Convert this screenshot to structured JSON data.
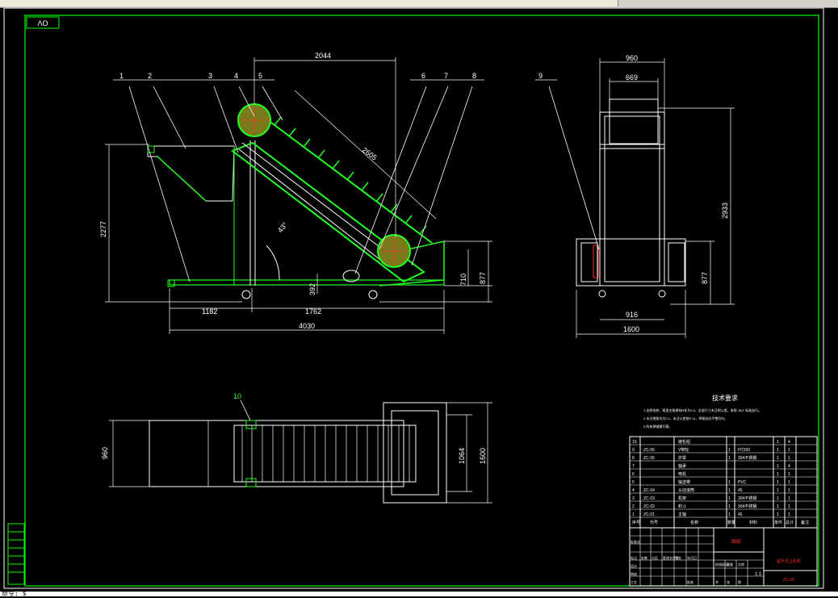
{
  "drawing_code": "ΛO",
  "side_view": {
    "part_numbers": [
      "1",
      "2",
      "3",
      "4",
      "5",
      "6",
      "7",
      "8"
    ],
    "dims": {
      "top_length": "2044",
      "conveyor_length": "2605",
      "overall_height": "2277",
      "angle": "43°",
      "low_height": "392",
      "discharge_height": "710",
      "end_height": "877",
      "base_left": "1182",
      "base_right": "1762",
      "overall_length": "4030"
    }
  },
  "end_view": {
    "part_number": "9",
    "dims": {
      "top_width": "960",
      "inner_width": "669",
      "height": "2933",
      "side_height": "877",
      "wheel_span": "916",
      "overall_width": "1600"
    }
  },
  "plan_view": {
    "part_number": "10",
    "dims": {
      "width_left": "960",
      "width_mid": "1064",
      "width_right": "1600"
    }
  },
  "notes": {
    "title": "技术要求",
    "lines": [
      "1.去除毛刺，铸造尖角倒钝R处为0.5，全部尺寸未注明公差，参照 JB/T 标准执行。",
      "2.未注倒角均为C1，未注公差按IT14，焊接处应平整均匀。",
      "3.所有焊缝需打磨。"
    ]
  },
  "bom": {
    "rows": [
      {
        "no": "10",
        "code": "",
        "name": "链轮组",
        "qty": "",
        "material": "",
        "a": "1",
        "b": "4"
      },
      {
        "no": "9",
        "code": "ZC-06",
        "name": "V带轮",
        "qty": "1",
        "material": "HT200",
        "a": "1",
        "b": "1"
      },
      {
        "no": "8",
        "code": "ZC-05",
        "name": "护罩",
        "qty": "1",
        "material": "304不锈钢",
        "a": "1",
        "b": "1"
      },
      {
        "no": "7",
        "code": "",
        "name": "轴承",
        "qty": "",
        "material": "",
        "a": "1",
        "b": "4"
      },
      {
        "no": "6",
        "code": "",
        "name": "电机",
        "qty": "",
        "material": "",
        "a": "1",
        "b": "1"
      },
      {
        "no": "5",
        "code": "",
        "name": "输送带",
        "qty": "1",
        "material": "PVC",
        "a": "1",
        "b": "1"
      },
      {
        "no": "4",
        "code": "ZC-04",
        "name": "从动滚筒",
        "qty": "1",
        "material": "45",
        "a": "1",
        "b": "1"
      },
      {
        "no": "3",
        "code": "ZC-03",
        "name": "机架",
        "qty": "1",
        "material": "304不锈钢",
        "a": "1",
        "b": "1"
      },
      {
        "no": "2",
        "code": "ZC-02",
        "name": "料斗",
        "qty": "1",
        "material": "304不锈钢",
        "a": "1",
        "b": "1"
      },
      {
        "no": "1",
        "code": "ZC-01",
        "name": "主轴",
        "qty": "1",
        "material": "45",
        "a": "1",
        "b": "1"
      }
    ],
    "header": {
      "no": "序号",
      "code": "代号",
      "name": "名称",
      "qty": "数量",
      "material": "材料",
      "a": "单件",
      "b": "总计",
      "note": "备注"
    }
  },
  "title_block": {
    "company": "图纸",
    "drawing_name": "提升式上料机",
    "drawing_no": "ZC-00",
    "scale": "1:1",
    "labels": [
      "标记",
      "处数",
      "分区",
      "更改文件号",
      "签名",
      "年月日",
      "设计",
      "审核",
      "工艺",
      "批准",
      "标准化",
      "阶段标记",
      "重量",
      "比例",
      "共",
      "张",
      "第"
    ]
  },
  "command_line": "命令: $",
  "colors": {
    "background": "#000000",
    "frame": "#00ff00",
    "geometry": "#ffffff",
    "hatch_green": "#22ff22",
    "dimension": "#ff3030",
    "circle_fill": "#7a7a1a",
    "text": "#ffffff"
  }
}
